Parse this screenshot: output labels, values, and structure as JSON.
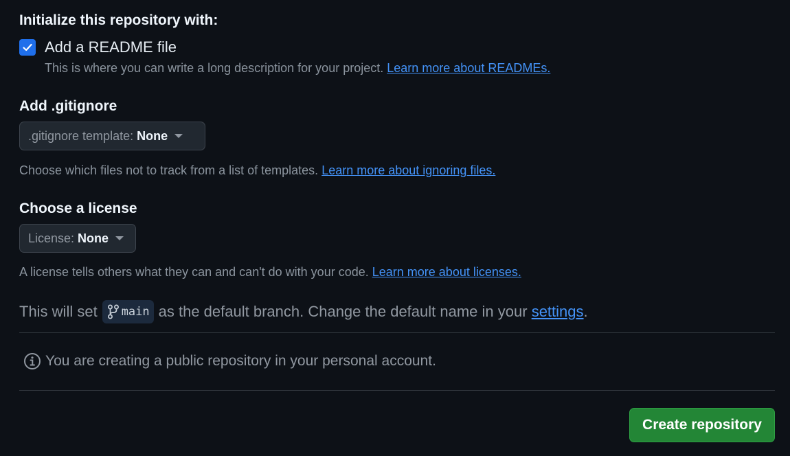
{
  "initialize": {
    "title": "Initialize this repository with:",
    "readme": {
      "checked": true,
      "label": "Add a README file",
      "description": "This is where you can write a long description for your project.",
      "link": "Learn more about READMEs."
    }
  },
  "gitignore": {
    "title": "Add .gitignore",
    "select_prefix": ".gitignore template:",
    "select_value": "None",
    "description": "Choose which files not to track from a list of templates.",
    "link": "Learn more about ignoring files."
  },
  "license": {
    "title": "Choose a license",
    "select_prefix": "License:",
    "select_value": "None",
    "description": "A license tells others what they can and can't do with your code.",
    "link": "Learn more about licenses."
  },
  "branch": {
    "prefix": "This will set",
    "name": "main",
    "middle": "as the default branch. Change the default name in your",
    "link": "settings",
    "suffix": "."
  },
  "info": {
    "icon": "info-icon",
    "text": "You are creating a public repository in your personal account."
  },
  "actions": {
    "create_label": "Create repository"
  },
  "colors": {
    "background": "#0d1117",
    "checkbox": "#1f6feb",
    "link": "#4493f8",
    "create_button": "#238636"
  }
}
